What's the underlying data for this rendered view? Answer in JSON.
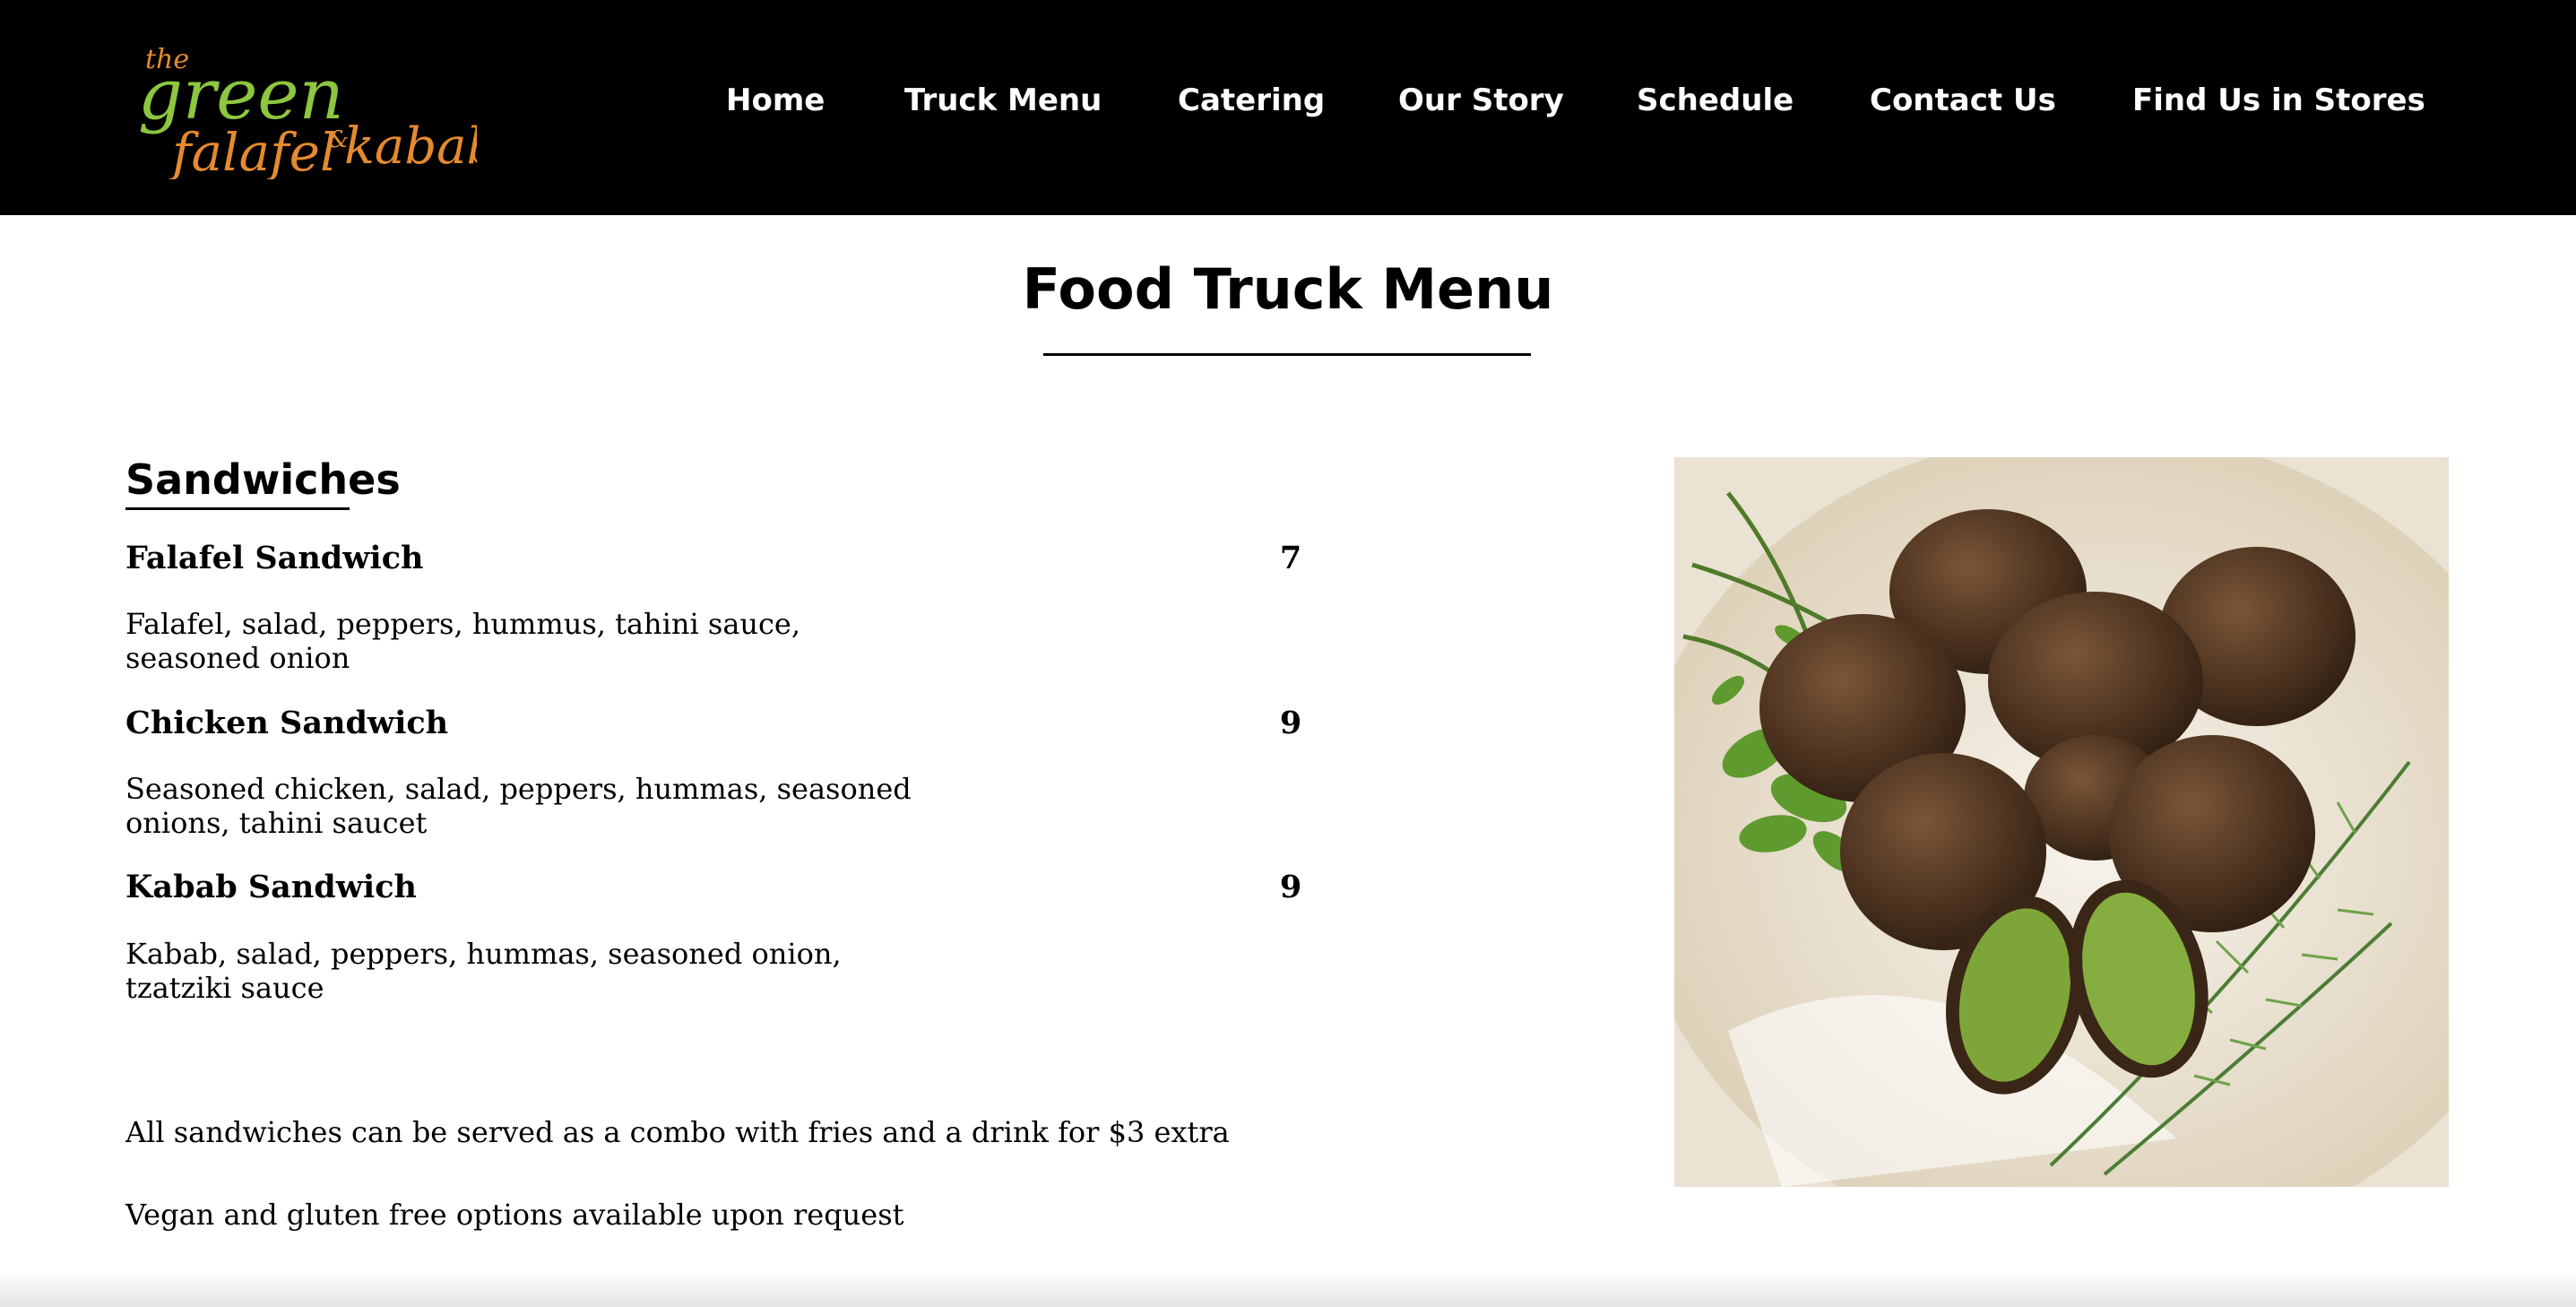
{
  "brand": {
    "logo_line1": "the",
    "logo_line2": "green",
    "logo_line3": "falafel",
    "logo_amp": "&",
    "logo_line4": "kabab",
    "logo_green": "#8dc63f",
    "logo_orange": "#e58a2e"
  },
  "nav": {
    "items": [
      {
        "label": "Home"
      },
      {
        "label": "Truck Menu"
      },
      {
        "label": "Catering"
      },
      {
        "label": "Our Story"
      },
      {
        "label": "Schedule"
      },
      {
        "label": "Contact Us"
      },
      {
        "label": "Find Us in Stores"
      }
    ]
  },
  "page": {
    "title": "Food Truck Menu"
  },
  "menu": {
    "section_title": "Sandwiches",
    "items": [
      {
        "name": "Falafel Sandwich",
        "price": "7",
        "description": "Falafel, salad, peppers, hummus, tahini sauce, seasoned onion"
      },
      {
        "name": "Chicken Sandwich",
        "price": "9",
        "description": "Seasoned chicken, salad, peppers, hummas, seasoned onions, tahini saucet"
      },
      {
        "name": "Kabab Sandwich",
        "price": "9",
        "description": "Kabab, salad, peppers, hummas, seasoned onion, tzatziki sauce"
      }
    ],
    "notes": [
      "All sandwiches can be served as a combo with fries and a drink for $3 extra",
      "Vegan and gluten free options available upon request"
    ]
  },
  "image": {
    "subject": "falafel-plate-icon"
  },
  "colors": {
    "header_bg": "#000000",
    "nav_text": "#ffffff",
    "text": "#000000"
  }
}
